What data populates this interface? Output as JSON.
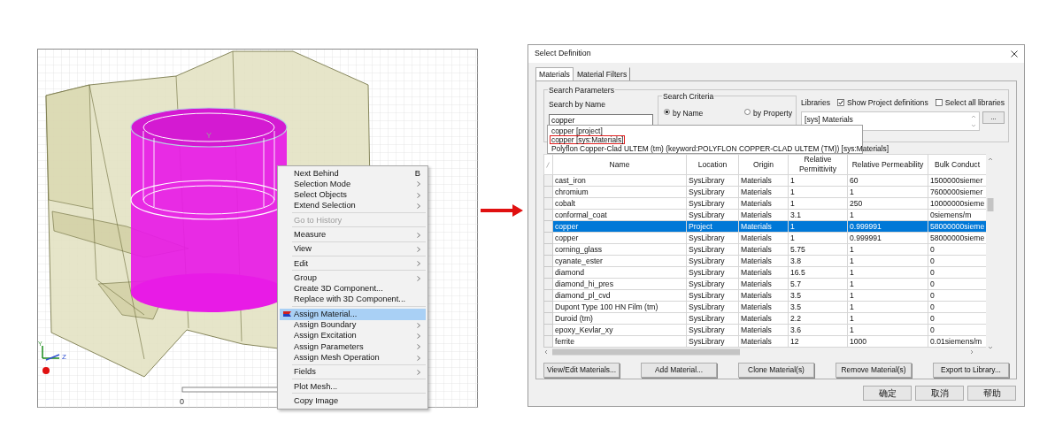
{
  "viewport": {
    "model_label": "Y",
    "triad_y_label": "Y",
    "triad_z_label": "Z",
    "scale_label": "0"
  },
  "context_menu": {
    "items": [
      {
        "kind": "item",
        "label": "Next Behind",
        "shortcut": "B",
        "submenu": false,
        "disabled": false,
        "selected": false
      },
      {
        "kind": "item",
        "label": "Selection Mode",
        "submenu": true,
        "disabled": false,
        "selected": false
      },
      {
        "kind": "item",
        "label": "Select Objects",
        "submenu": true,
        "disabled": false,
        "selected": false
      },
      {
        "kind": "item",
        "label": "Extend Selection",
        "submenu": true,
        "disabled": false,
        "selected": false
      },
      {
        "kind": "separator"
      },
      {
        "kind": "item",
        "label": "Go to History",
        "submenu": false,
        "disabled": true,
        "selected": false
      },
      {
        "kind": "separator"
      },
      {
        "kind": "item",
        "label": "Measure",
        "submenu": true,
        "disabled": false,
        "selected": false
      },
      {
        "kind": "separator"
      },
      {
        "kind": "item",
        "label": "View",
        "submenu": true,
        "disabled": false,
        "selected": false
      },
      {
        "kind": "separator"
      },
      {
        "kind": "item",
        "label": "Edit",
        "submenu": true,
        "disabled": false,
        "selected": false
      },
      {
        "kind": "separator"
      },
      {
        "kind": "item",
        "label": "Group",
        "submenu": true,
        "disabled": false,
        "selected": false
      },
      {
        "kind": "item",
        "label": "Create 3D Component...",
        "submenu": false,
        "disabled": false,
        "selected": false
      },
      {
        "kind": "item",
        "label": "Replace with 3D Component...",
        "submenu": false,
        "disabled": false,
        "selected": false
      },
      {
        "kind": "separator"
      },
      {
        "kind": "item",
        "label": "Assign Material...",
        "submenu": false,
        "disabled": false,
        "selected": true,
        "icon": true
      },
      {
        "kind": "item",
        "label": "Assign Boundary",
        "submenu": true,
        "disabled": false,
        "selected": false
      },
      {
        "kind": "item",
        "label": "Assign Excitation",
        "submenu": true,
        "disabled": false,
        "selected": false
      },
      {
        "kind": "item",
        "label": "Assign Parameters",
        "submenu": true,
        "disabled": false,
        "selected": false
      },
      {
        "kind": "item",
        "label": "Assign Mesh Operation",
        "submenu": true,
        "disabled": false,
        "selected": false
      },
      {
        "kind": "separator"
      },
      {
        "kind": "item",
        "label": "Fields",
        "submenu": true,
        "disabled": false,
        "selected": false
      },
      {
        "kind": "separator"
      },
      {
        "kind": "item",
        "label": "Plot Mesh...",
        "submenu": false,
        "disabled": false,
        "selected": false
      },
      {
        "kind": "separator"
      },
      {
        "kind": "item",
        "label": "Copy Image",
        "submenu": false,
        "disabled": false,
        "selected": false
      }
    ]
  },
  "dialog": {
    "title": "Select Definition",
    "tabs": [
      {
        "label": "Materials",
        "selected": true
      },
      {
        "label": "Material Filters",
        "selected": false
      }
    ],
    "search_parameters": {
      "title": "Search Parameters",
      "search_label": "Search by Name",
      "search_value": "copper",
      "criteria_title": "Search Criteria",
      "criteria": [
        {
          "label": "by Name",
          "selected": true
        },
        {
          "label": "by Property",
          "selected": false
        }
      ],
      "libraries_label": "Libraries",
      "show_project": {
        "label": "Show Project definitions",
        "checked": true
      },
      "select_all": {
        "label": "Select all libraries",
        "checked": false
      },
      "library_list": [
        "[sys] Materials"
      ],
      "browse_button": "..."
    },
    "suggestions": [
      {
        "text": "copper [project]",
        "marked": false
      },
      {
        "text": "copper [sys:Materials]",
        "marked": true
      },
      {
        "text": "Polyflon Copper-Clad ULTEM (tm) (keyword:POLYFLON COPPER-CLAD ULTEM (TM)) [sys:Materials]",
        "marked": false
      }
    ],
    "table": {
      "columns": [
        "Name",
        "Location",
        "Origin",
        "Relative Permittivity",
        "Relative Permeability",
        "Bulk Conduct"
      ],
      "rows": [
        {
          "cells": [
            "cast_iron",
            "SysLibrary",
            "Materials",
            "1",
            "60",
            "1500000siemer"
          ],
          "selected": false
        },
        {
          "cells": [
            "chromium",
            "SysLibrary",
            "Materials",
            "1",
            "1",
            "7600000siemer"
          ],
          "selected": false
        },
        {
          "cells": [
            "cobalt",
            "SysLibrary",
            "Materials",
            "1",
            "250",
            "10000000sieme"
          ],
          "selected": false
        },
        {
          "cells": [
            "conformal_coat",
            "SysLibrary",
            "Materials",
            "3.1",
            "1",
            "0siemens/m"
          ],
          "selected": false
        },
        {
          "cells": [
            "copper",
            "Project",
            "Materials",
            "1",
            "0.999991",
            "58000000sieme"
          ],
          "selected": true
        },
        {
          "cells": [
            "copper",
            "SysLibrary",
            "Materials",
            "1",
            "0.999991",
            "58000000sieme"
          ],
          "selected": false
        },
        {
          "cells": [
            "corning_glass",
            "SysLibrary",
            "Materials",
            "5.75",
            "1",
            "0"
          ],
          "selected": false
        },
        {
          "cells": [
            "cyanate_ester",
            "SysLibrary",
            "Materials",
            "3.8",
            "1",
            "0"
          ],
          "selected": false
        },
        {
          "cells": [
            "diamond",
            "SysLibrary",
            "Materials",
            "16.5",
            "1",
            "0"
          ],
          "selected": false
        },
        {
          "cells": [
            "diamond_hi_pres",
            "SysLibrary",
            "Materials",
            "5.7",
            "1",
            "0"
          ],
          "selected": false
        },
        {
          "cells": [
            "diamond_pl_cvd",
            "SysLibrary",
            "Materials",
            "3.5",
            "1",
            "0"
          ],
          "selected": false
        },
        {
          "cells": [
            "Dupont Type 100 HN Film (tm)",
            "SysLibrary",
            "Materials",
            "3.5",
            "1",
            "0"
          ],
          "selected": false
        },
        {
          "cells": [
            "Duroid (tm)",
            "SysLibrary",
            "Materials",
            "2.2",
            "1",
            "0"
          ],
          "selected": false
        },
        {
          "cells": [
            "epoxy_Kevlar_xy",
            "SysLibrary",
            "Materials",
            "3.6",
            "1",
            "0"
          ],
          "selected": false
        },
        {
          "cells": [
            "ferrite",
            "SysLibrary",
            "Materials",
            "12",
            "1000",
            "0.01siemens/m"
          ],
          "selected": false
        }
      ]
    },
    "buttons": [
      "View/Edit Materials...",
      "Add Material...",
      "Clone Material(s)",
      "Remove Material(s)",
      "Export to Library..."
    ],
    "footer_buttons": [
      "确定",
      "取消",
      "帮助"
    ]
  }
}
